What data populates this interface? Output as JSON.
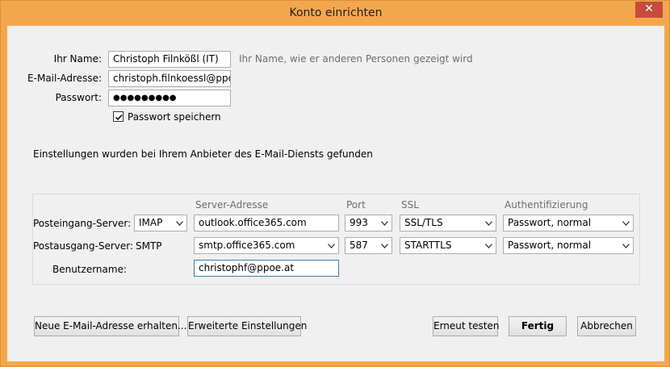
{
  "window": {
    "title": "Konto einrichten",
    "close_glyph": "✕"
  },
  "account": {
    "name_label": "Ihr Name:",
    "name_value": "Christoph Filnkößl (IT)",
    "name_hint": "Ihr Name, wie er anderen Personen gezeigt wird",
    "email_label": "E-Mail-Adresse:",
    "email_value": "christoph.filnkoessl@ppoe.",
    "password_label": "Passwort:",
    "password_value": "●●●●●●●●●",
    "remember_label": "Passwort speichern",
    "remember_checked": true
  },
  "status_text": "Einstellungen wurden bei Ihrem Anbieter des E-Mail-Diensts gefunden",
  "servers": {
    "headers": {
      "address": "Server-Adresse",
      "port": "Port",
      "ssl": "SSL",
      "auth": "Authentifizierung"
    },
    "incoming": {
      "label": "Posteingang-Server:",
      "protocol": "IMAP",
      "address": "outlook.office365.com",
      "port": "993",
      "ssl": "SSL/TLS",
      "auth": "Passwort, normal"
    },
    "outgoing": {
      "label": "Postausgang-Server:",
      "protocol": "SMTP",
      "address": "smtp.office365.com",
      "port": "587",
      "ssl": "STARTTLS",
      "auth": "Passwort, normal"
    },
    "username_label": "Benutzername:",
    "username_value": "christophf@ppoe.at"
  },
  "buttons": {
    "new_address": "Neue E-Mail-Adresse erhalten...",
    "advanced": "Erweiterte Einstellungen",
    "retest": "Erneut testen",
    "done": "Fertig",
    "cancel": "Abbrechen"
  },
  "colors": {
    "title_bar": "#f3a74d",
    "close_button": "#c74b3b",
    "client_bg": "#f0f0f0",
    "focus_border": "#3c7fb1"
  }
}
